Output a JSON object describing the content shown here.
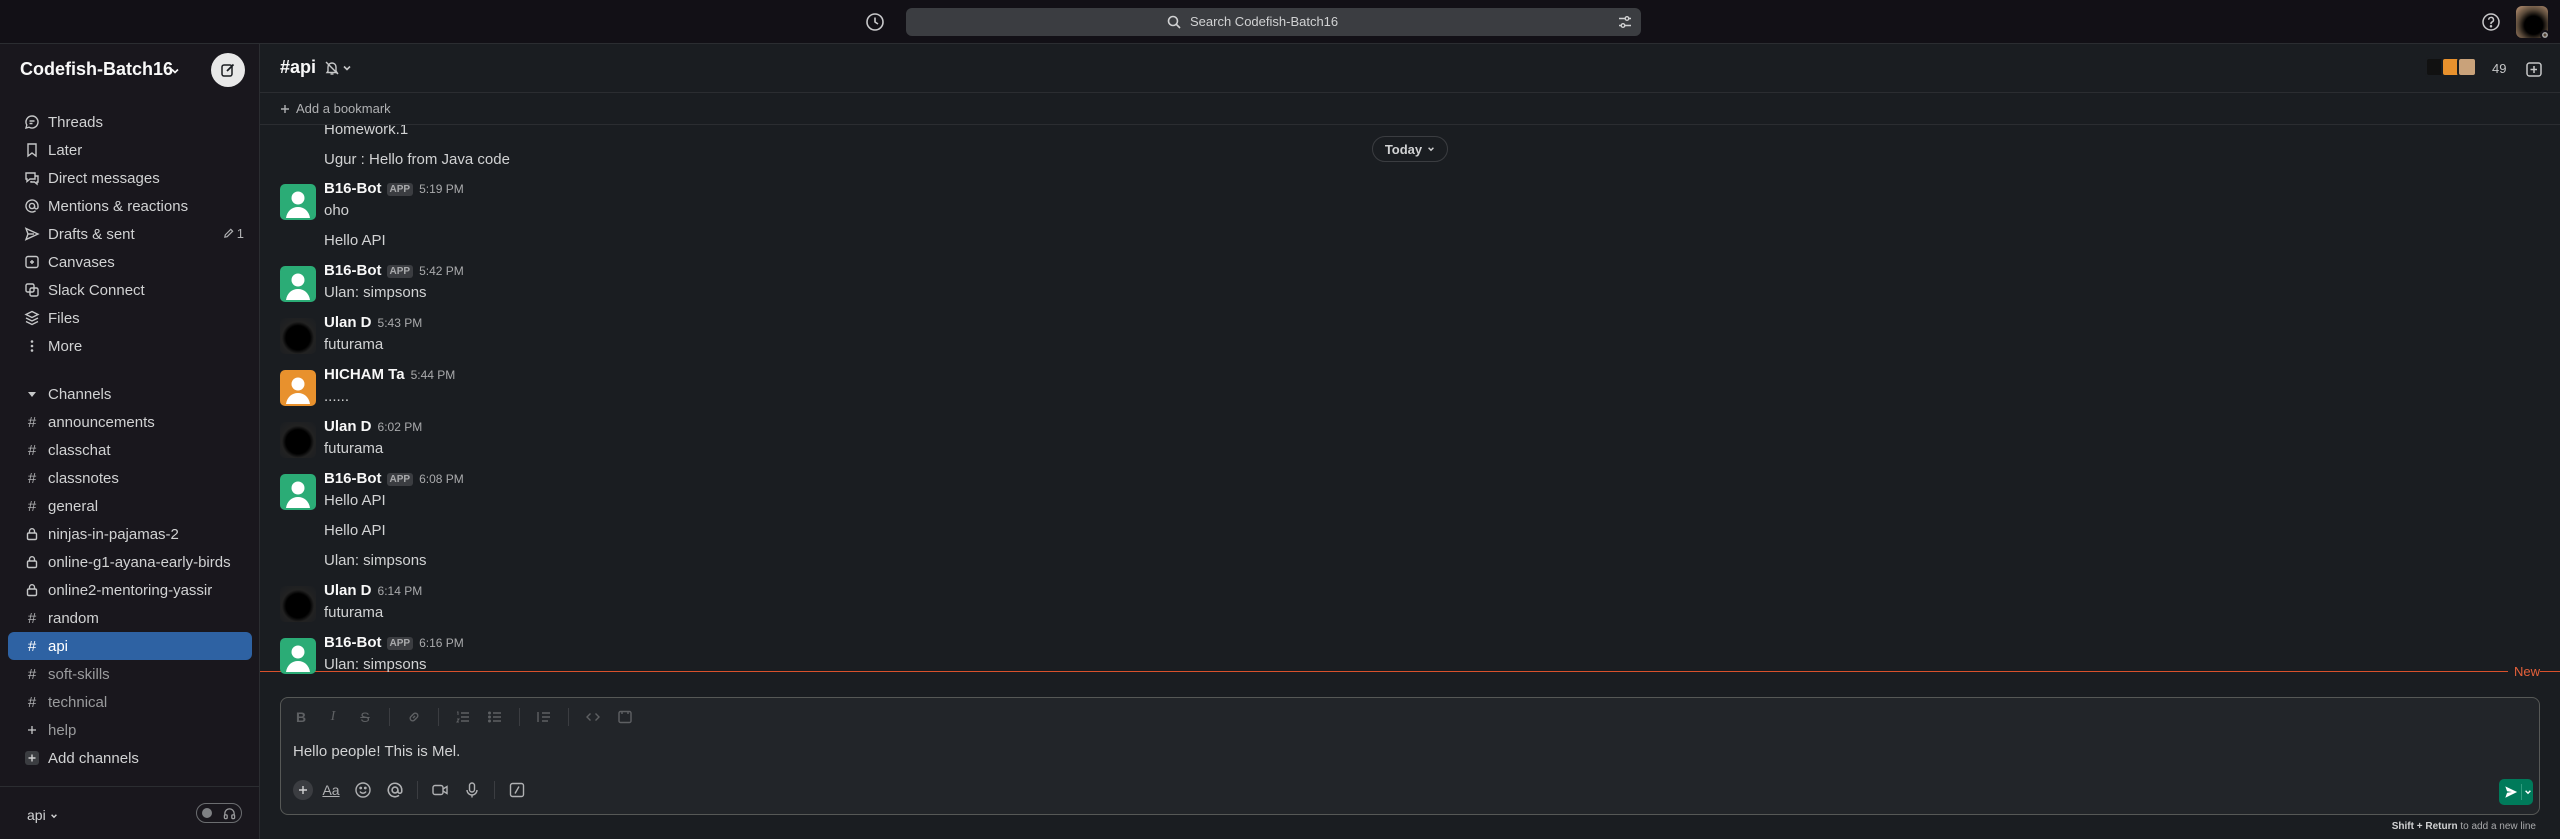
{
  "topbar": {
    "search_placeholder": "Search Codefish-Batch16",
    "icons": [
      "history-icon",
      "search-icon",
      "filter-icon",
      "help-icon",
      "avatar"
    ]
  },
  "sidebar": {
    "workspace_name": "Codefish-Batch16",
    "nav": [
      {
        "label": "Threads",
        "icon": "threads-icon"
      },
      {
        "label": "Later",
        "icon": "bookmark-icon"
      },
      {
        "label": "Direct messages",
        "icon": "messages-icon"
      },
      {
        "label": "Mentions & reactions",
        "icon": "at-icon"
      },
      {
        "label": "Drafts & sent",
        "icon": "send-icon",
        "count": "1"
      },
      {
        "label": "Canvases",
        "icon": "canvas-icon"
      },
      {
        "label": "Slack Connect",
        "icon": "connect-icon"
      },
      {
        "label": "Files",
        "icon": "files-icon"
      },
      {
        "label": "More",
        "icon": "more-icon"
      }
    ],
    "channels_header": "Channels",
    "channels": [
      {
        "name": "announcements",
        "private": false
      },
      {
        "name": "classchat",
        "private": false
      },
      {
        "name": "classnotes",
        "private": false
      },
      {
        "name": "general",
        "private": false
      },
      {
        "name": "ninjas-in-pajamas-2",
        "private": true
      },
      {
        "name": "online-g1-ayana-early-birds",
        "private": true
      },
      {
        "name": "online2-mentoring-yassir",
        "private": true
      },
      {
        "name": "random",
        "private": false
      },
      {
        "name": "api",
        "private": false,
        "active": true
      },
      {
        "name": "soft-skills",
        "private": false
      },
      {
        "name": "technical",
        "private": false
      },
      {
        "name": "help",
        "private": false
      }
    ],
    "add_channels": "Add channels",
    "footer_label": "api"
  },
  "channel": {
    "name": "api",
    "member_count": "49",
    "add_bookmark": "Add a bookmark"
  },
  "messages": {
    "today_label": "Today",
    "new_label": "New",
    "items": [
      {
        "type": "cont",
        "text": "Homework.1"
      },
      {
        "type": "cont",
        "text": "Ugur : Hello from Java code"
      },
      {
        "type": "msg",
        "sender": "B16-Bot",
        "app": "APP",
        "time": "5:19 PM",
        "text": "oho",
        "avatar": "bot"
      },
      {
        "type": "cont",
        "text": "Hello API"
      },
      {
        "type": "msg",
        "sender": "B16-Bot",
        "app": "APP",
        "time": "5:42 PM",
        "text": "Ulan: simpsons",
        "avatar": "bot"
      },
      {
        "type": "msg",
        "sender": "Ulan D",
        "time": "5:43 PM",
        "text": "futurama",
        "avatar": "ulan"
      },
      {
        "type": "msg",
        "sender": "HICHAM Ta",
        "time": "5:44 PM",
        "text": "......",
        "avatar": "hicham"
      },
      {
        "type": "msg",
        "sender": "Ulan D",
        "time": "6:02 PM",
        "text": "futurama",
        "avatar": "ulan"
      },
      {
        "type": "msg",
        "sender": "B16-Bot",
        "app": "APP",
        "time": "6:08 PM",
        "text": "Hello API",
        "avatar": "bot"
      },
      {
        "type": "cont",
        "text": "Hello API"
      },
      {
        "type": "cont",
        "text": "Ulan: simpsons"
      },
      {
        "type": "msg",
        "sender": "Ulan D",
        "time": "6:14 PM",
        "text": "futurama",
        "avatar": "ulan"
      },
      {
        "type": "msg",
        "sender": "B16-Bot",
        "app": "APP",
        "time": "6:16 PM",
        "text": "Ulan: simpsons",
        "avatar": "bot"
      }
    ]
  },
  "composer": {
    "value": "Hello people! This is Mel.",
    "hint_keys": "Shift + Return",
    "hint_text": "to add a new line"
  },
  "colors": {
    "sidebar_bg": "#19171d",
    "main_bg": "#1a1d21",
    "active_channel": "#2e62a3",
    "new_divider": "#d9512c",
    "send_button": "#007a5a",
    "bot_avatar": "#2bac76"
  }
}
